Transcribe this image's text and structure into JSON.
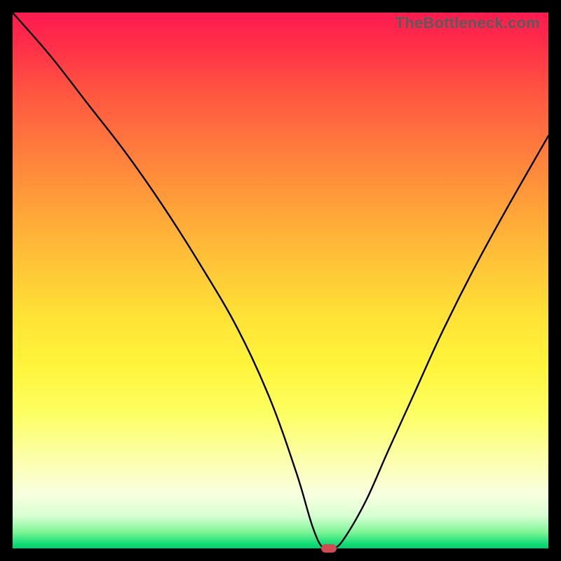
{
  "watermark": "TheBottleneck.com",
  "colors": {
    "frame": "#000000",
    "curve": "#000000",
    "marker": "#d24a52",
    "gradient_top": "#ff1a50",
    "gradient_bottom": "#00cf70"
  },
  "chart_data": {
    "type": "line",
    "title": "",
    "xlabel": "",
    "ylabel": "",
    "xlim": [
      0,
      100
    ],
    "ylim": [
      0,
      100
    ],
    "grid": false,
    "legend": false,
    "annotations": [
      {
        "text": "TheBottleneck.com",
        "position": "top-right"
      }
    ],
    "series": [
      {
        "name": "bottleneck-curve",
        "x": [
          0,
          7,
          14,
          21,
          28,
          35,
          42,
          48,
          53,
          56,
          58,
          60,
          62,
          66,
          70,
          75,
          80,
          86,
          92,
          100
        ],
        "values": [
          100,
          92,
          83,
          74,
          64,
          53,
          41,
          28,
          14,
          4,
          0,
          0,
          2,
          9,
          18,
          29,
          40,
          52,
          63,
          77
        ]
      }
    ],
    "marker": {
      "x": 59,
      "y": 0
    },
    "background": {
      "description": "vertical gradient red→orange→yellow→pale→green mapping bottleneck severity (top=high, bottom=low)"
    }
  }
}
